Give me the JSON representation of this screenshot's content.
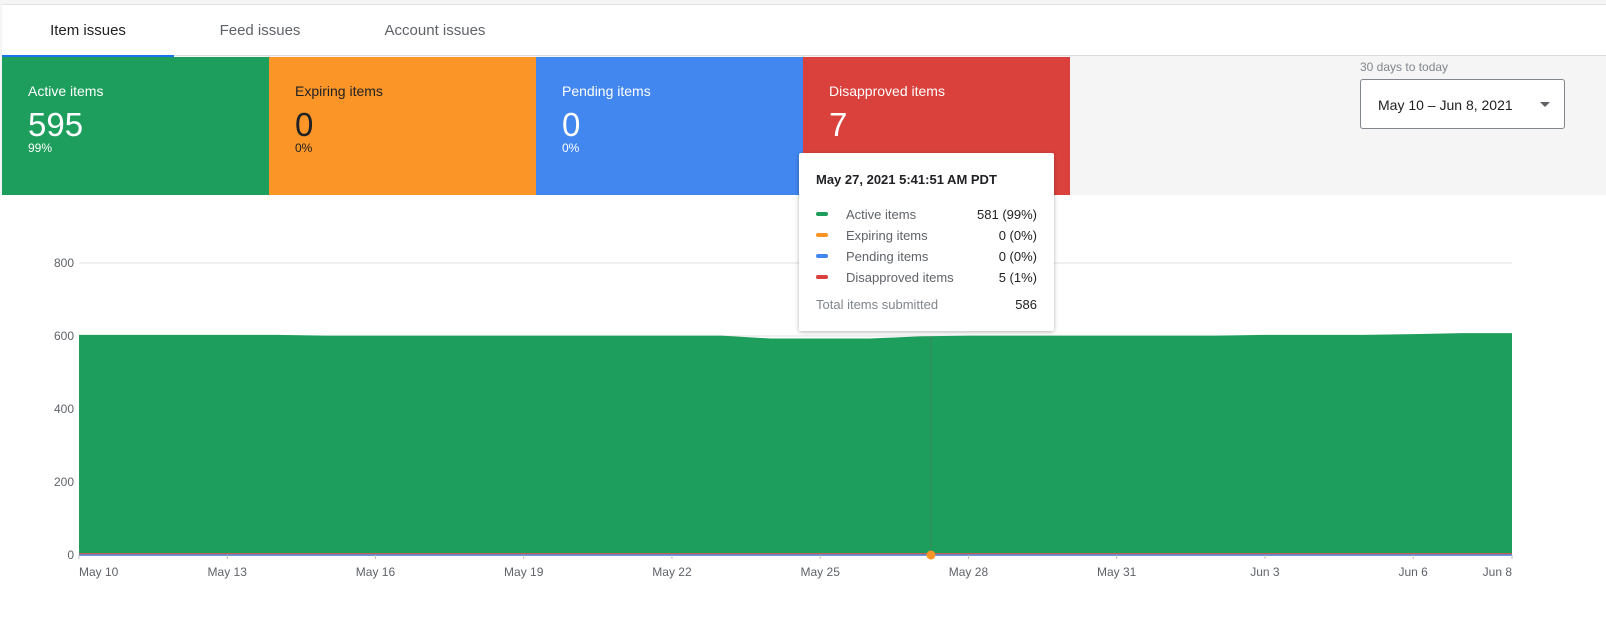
{
  "tabs": [
    {
      "label": "Item issues"
    },
    {
      "label": "Feed issues"
    },
    {
      "label": "Account issues"
    }
  ],
  "cards": [
    {
      "label": "Active items",
      "value": "595",
      "pct": "99%"
    },
    {
      "label": "Expiring items",
      "value": "0",
      "pct": "0%"
    },
    {
      "label": "Pending items",
      "value": "0",
      "pct": "0%"
    },
    {
      "label": "Disapproved items",
      "value": "7",
      "pct": ""
    }
  ],
  "date_range": {
    "caption": "30 days to today",
    "value": "May 10 – Jun 8, 2021"
  },
  "tooltip": {
    "title": "May 27, 2021 5:41:51 AM PDT",
    "rows": [
      {
        "name": "Active items",
        "value": "581 (99%)"
      },
      {
        "name": "Expiring items",
        "value": "0 (0%)"
      },
      {
        "name": "Pending items",
        "value": "0 (0%)"
      },
      {
        "name": "Disapproved items",
        "value": "5 (1%)"
      }
    ],
    "total_label": "Total items submitted",
    "total_value": "586"
  },
  "colors": {
    "active": "#1e9e5c",
    "expiring": "#fb9528",
    "pending": "#4286f0",
    "disapproved": "#da413c"
  },
  "chart_data": {
    "type": "area",
    "x": [
      "May 10",
      "May 11",
      "May 12",
      "May 13",
      "May 14",
      "May 15",
      "May 16",
      "May 17",
      "May 18",
      "May 19",
      "May 20",
      "May 21",
      "May 22",
      "May 23",
      "May 24",
      "May 25",
      "May 26",
      "May 27",
      "May 28",
      "May 29",
      "May 30",
      "May 31",
      "Jun 1",
      "Jun 2",
      "Jun 3",
      "Jun 4",
      "Jun 5",
      "Jun 6",
      "Jun 7",
      "Jun 8"
    ],
    "x_ticks": [
      "May 10",
      "May 13",
      "May 16",
      "May 19",
      "May 22",
      "May 25",
      "May 28",
      "May 31",
      "Jun 3",
      "Jun 6",
      "Jun 8"
    ],
    "y_ticks": [
      0,
      200,
      400,
      600,
      800
    ],
    "ylim": [
      0,
      800
    ],
    "series": [
      {
        "name": "Active items",
        "values": [
          598,
          598,
          598,
          598,
          598,
          596,
          596,
          596,
          596,
          596,
          596,
          596,
          596,
          596,
          588,
          588,
          588,
          594,
          596,
          596,
          596,
          596,
          596,
          596,
          598,
          598,
          598,
          600,
          603,
          603
        ]
      },
      {
        "name": "Disapproved items",
        "values": [
          5,
          5,
          5,
          5,
          5,
          5,
          5,
          5,
          5,
          5,
          5,
          5,
          5,
          5,
          5,
          5,
          5,
          5,
          5,
          5,
          5,
          5,
          5,
          5,
          5,
          5,
          5,
          5,
          5,
          5
        ]
      },
      {
        "name": "Expiring items",
        "values": [
          0,
          0,
          0,
          0,
          0,
          0,
          0,
          0,
          0,
          0,
          0,
          0,
          0,
          0,
          0,
          0,
          0,
          0,
          0,
          0,
          0,
          0,
          0,
          0,
          0,
          0,
          0,
          0,
          0,
          0
        ]
      },
      {
        "name": "Pending items",
        "values": [
          0,
          0,
          0,
          0,
          0,
          0,
          0,
          0,
          0,
          0,
          0,
          0,
          0,
          0,
          0,
          0,
          0,
          0,
          0,
          0,
          0,
          0,
          0,
          0,
          0,
          0,
          0,
          0,
          0,
          0
        ]
      }
    ],
    "hover_x": "May 27",
    "grid": true
  }
}
